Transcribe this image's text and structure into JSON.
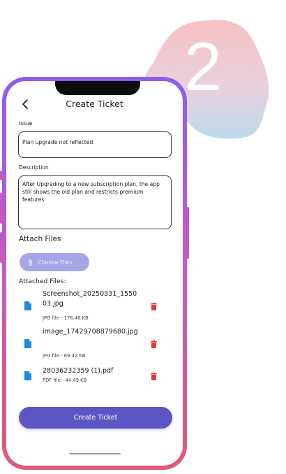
{
  "step": {
    "number": "2"
  },
  "colors": {
    "accent": "#5e55c5",
    "choose_button": "#a6a6e6",
    "delete": "#e53935",
    "file_icon": "#1e88e5",
    "frame_top": "#8e5cf0",
    "frame_bottom": "#e05a70"
  },
  "header": {
    "title": "Create Ticket",
    "back_icon": "chevron-left-icon"
  },
  "issue": {
    "label": "Issue",
    "value": "Plan upgrade not reflected"
  },
  "description": {
    "label": "Description",
    "value": "After Upgrading to a new subscription plan, the app still shows the old plan and restricts premium features."
  },
  "attach": {
    "heading": "Attach Files",
    "choose_label": "Choose Files",
    "choose_icon": "paperclip-icon"
  },
  "attached": {
    "heading": "Attached Files:",
    "files": [
      {
        "name": "Screenshot_20250331_155003.jpg",
        "meta": "JPG file - 176.46 KB",
        "icon": "file-icon",
        "delete_icon": "trash-icon"
      },
      {
        "name": "image_17429708879680.jpg",
        "meta": "JPG file - 69.42 KB",
        "icon": "file-icon",
        "delete_icon": "trash-icon"
      },
      {
        "name": "28036232359 (1).pdf",
        "meta": "PDF file - 44.49 KB",
        "icon": "file-icon",
        "delete_icon": "trash-icon"
      }
    ]
  },
  "submit": {
    "label": "Create Ticket"
  }
}
